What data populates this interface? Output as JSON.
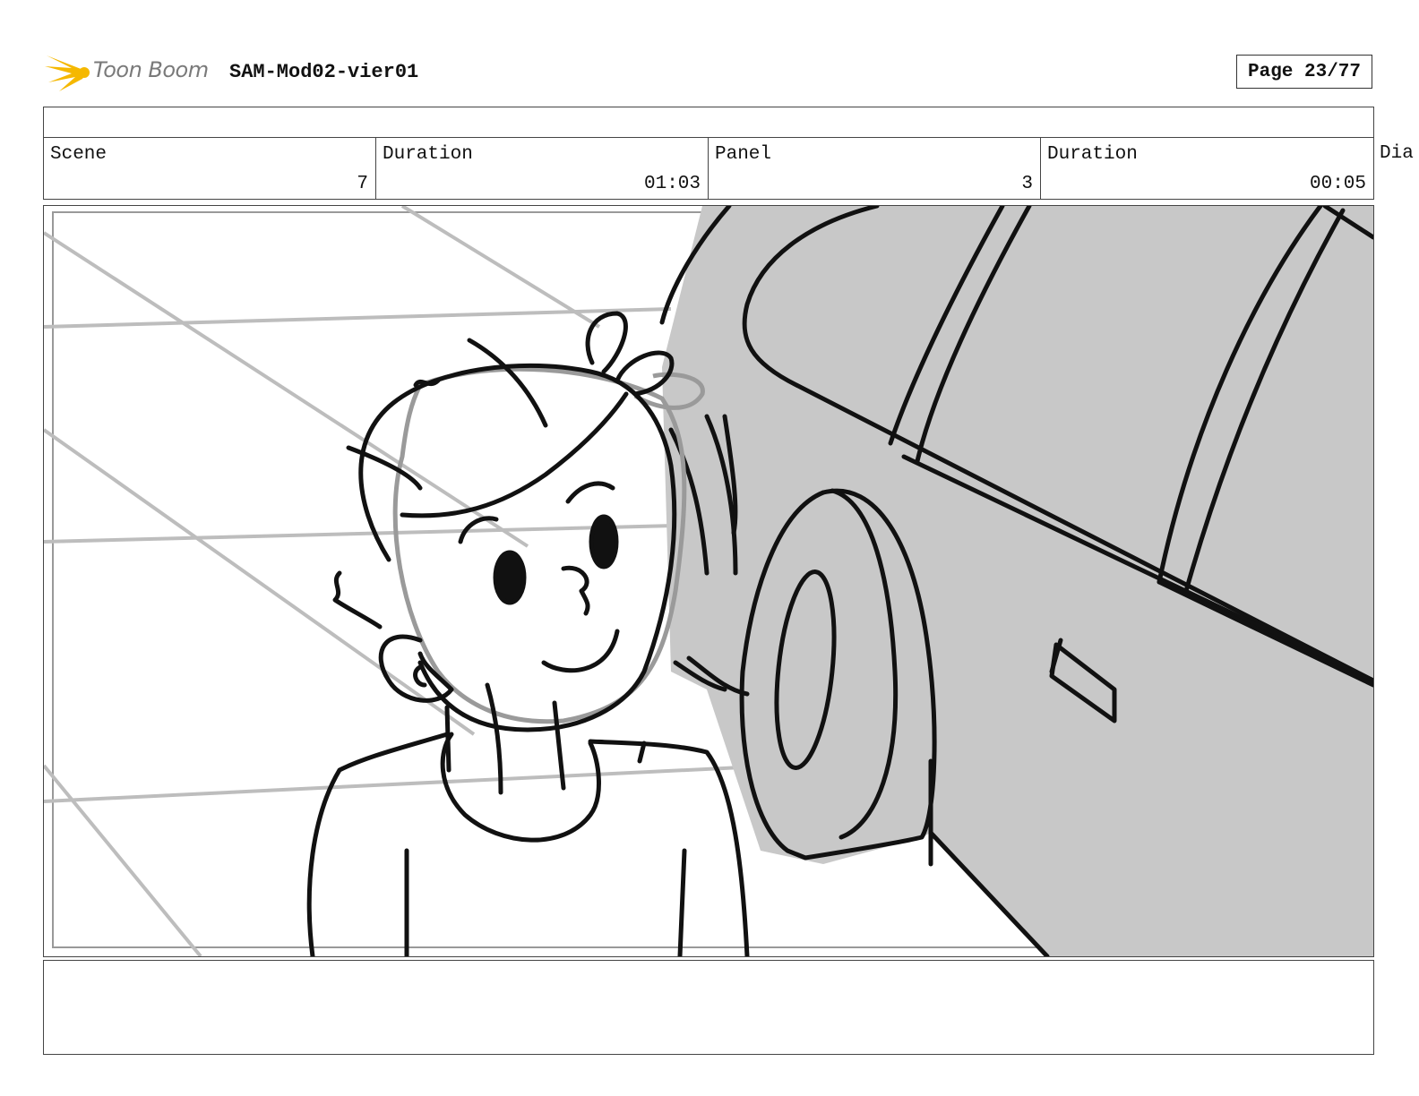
{
  "header": {
    "logo_text": "Toon Boom",
    "project_title": "SAM-Mod02-vier01",
    "page_indicator": "Page 23/77"
  },
  "info": {
    "scene_label": "Scene",
    "scene_value": "7",
    "scene_duration_label": "Duration",
    "scene_duration_value": "01:03",
    "panel_label": "Panel",
    "panel_value": "3",
    "panel_duration_label": "Duration",
    "panel_duration_value": "00:05",
    "dialog_label_truncated": "Dia"
  },
  "colors": {
    "logo_star": "#f5b800",
    "sketch_gray": "#c8c8c8",
    "guide_gray": "#bdbdbd",
    "ink": "#111111"
  }
}
